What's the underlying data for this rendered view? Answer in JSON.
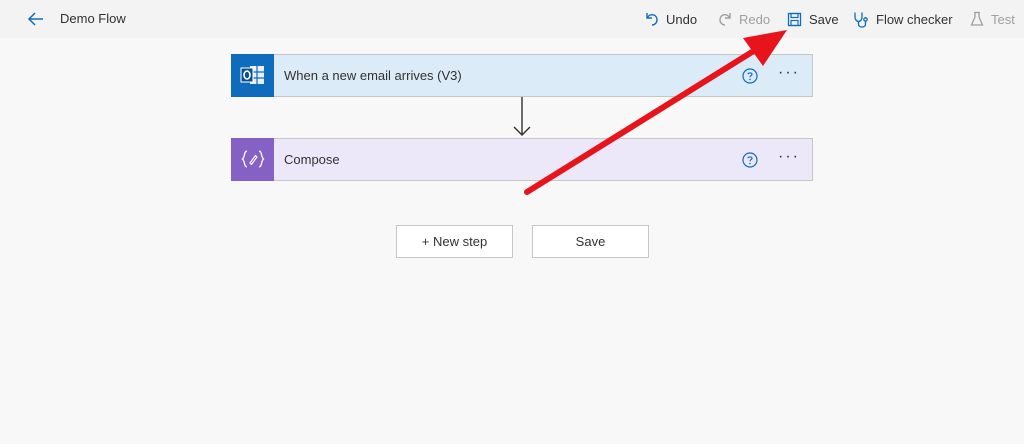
{
  "header": {
    "title": "Demo Flow",
    "commands": {
      "undo": "Undo",
      "redo": "Redo",
      "save": "Save",
      "flow_checker": "Flow checker",
      "test": "Test"
    }
  },
  "steps": [
    {
      "label": "When a new email arrives (V3)",
      "icon": "outlook-icon",
      "color": "#0f6cbd"
    },
    {
      "label": "Compose",
      "icon": "compose-icon",
      "color": "#8661c5"
    }
  ],
  "actions": {
    "new_step": "+ New step",
    "save": "Save"
  },
  "colors": {
    "accent": "#0f6cbd",
    "annotation_arrow": "#e8141b"
  }
}
